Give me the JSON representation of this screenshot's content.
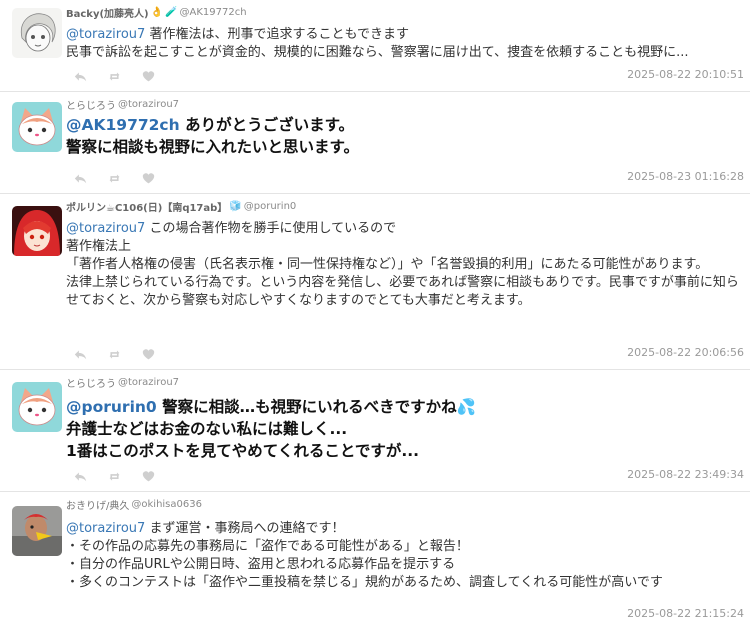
{
  "posts": [
    {
      "author": {
        "name": "Backy(加藤亮人)",
        "handle": "@AK19772ch",
        "emojis": [
          "👌",
          "🧪"
        ]
      },
      "mention": "@torazirou7",
      "lines": [
        "著作権法は、刑事で追求することもできます",
        "民事で訴訟を起こすことが資金的、規模的に困難なら、警察署に届け出て、捜査を依頼することも視野に..."
      ],
      "timestamp": "2025-08-22 20:10:51"
    },
    {
      "author": {
        "name": "とらじろう",
        "handle": "@torazirou7"
      },
      "mention": "@AK19772ch",
      "lines": [
        "ありがとうございます。",
        "警察に相談も視野に入れたいと思います。"
      ],
      "timestamp": "2025-08-23 01:16:28"
    },
    {
      "author": {
        "name": "ポルリン☕C106(日)【南q17ab】",
        "handle": "@porurin0",
        "emojis": [
          "🧊"
        ]
      },
      "mention": "@torazirou7",
      "lines": [
        "この場合著作物を勝手に使用しているので",
        "著作権法上",
        "「著作者人格権の侵害（氏名表示権・同一性保持権など）」や「名誉毀損的利用」にあたる可能性があります。",
        "法律上禁じられている行為です。という内容を発信し、必要であれば警察に相談もありです。民事ですが事前に知らせておくと、次から警察も対応しやすくなりますのでとても大事だと考えます。"
      ],
      "timestamp": "2025-08-22 20:06:56"
    },
    {
      "author": {
        "name": "とらじろう",
        "handle": "@torazirou7"
      },
      "mention": "@porurin0",
      "lines": [
        "警察に相談…も視野にいれるべきですかね💦",
        "弁護士などはお金のない私には難しく...",
        "1番はこのポストを見てやめてくれることですが..."
      ],
      "timestamp": "2025-08-22 23:49:34"
    },
    {
      "author": {
        "name": "おきりげ/典久",
        "handle": "@okihisa0636"
      },
      "mention": "@torazirou7",
      "lines": [
        "まず運営・事務局への連絡です！",
        "・その作品の応募先の事務局に「盗作である可能性がある」と報告！",
        "・自分の作品URLや公開日時、盗用と思われる応募作品を提示する",
        "・多くのコンテストは「盗作や二重投稿を禁じる」規約があるため、調査してくれる可能性が高いです"
      ],
      "timestamp": "2025-08-22 21:15:24"
    }
  ],
  "icons": {
    "reply": "reply-icon",
    "repost": "repost-icon",
    "like": "heart-icon"
  },
  "colors": {
    "mention": "#3a78b5",
    "icon": "#c9c9c9",
    "timestamp": "#9a9a9a"
  }
}
